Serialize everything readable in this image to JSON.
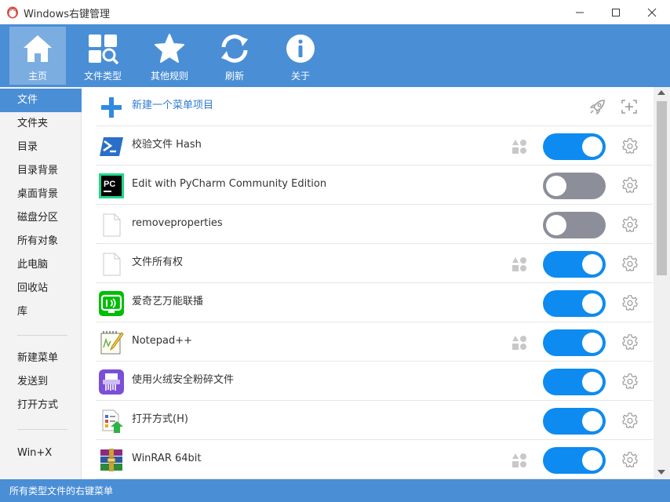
{
  "window": {
    "title": "Windows右键管理"
  },
  "toolbar": {
    "items": [
      {
        "label": "主页",
        "icon": "home-icon",
        "active": true
      },
      {
        "label": "文件类型",
        "icon": "file-type-search-icon",
        "active": false
      },
      {
        "label": "其他规则",
        "icon": "star-icon",
        "active": false
      },
      {
        "label": "刷新",
        "icon": "refresh-icon",
        "active": false
      },
      {
        "label": "关于",
        "icon": "info-icon",
        "active": false
      }
    ]
  },
  "sidebar": {
    "items": [
      {
        "label": "文件",
        "active": true
      },
      {
        "label": "文件夹"
      },
      {
        "label": "目录"
      },
      {
        "label": "目录背景"
      },
      {
        "label": "桌面背景"
      },
      {
        "label": "磁盘分区"
      },
      {
        "label": "所有对象"
      },
      {
        "label": "此电脑"
      },
      {
        "label": "回收站"
      },
      {
        "label": "库"
      },
      {
        "label": "新建菜单"
      },
      {
        "label": "发送到"
      },
      {
        "label": "打开方式"
      },
      {
        "label": "Win+X"
      }
    ]
  },
  "main": {
    "new_item_label": "新建一个菜单项目",
    "rows": [
      {
        "label": "校验文件 Hash",
        "icon": "powershell-icon",
        "enabled": true,
        "perm": true
      },
      {
        "label": "Edit with PyCharm Community Edition",
        "icon": "pycharm-icon",
        "enabled": false,
        "perm": false
      },
      {
        "label": "removeproperties",
        "icon": "blank-file-icon",
        "enabled": false,
        "perm": false
      },
      {
        "label": "文件所有权",
        "icon": "blank-file-icon",
        "enabled": true,
        "perm": true
      },
      {
        "label": "爱奇艺万能联播",
        "icon": "iqiyi-icon",
        "enabled": true,
        "perm": false
      },
      {
        "label": "Notepad++",
        "icon": "notepadpp-icon",
        "enabled": true,
        "perm": true
      },
      {
        "label": "使用火绒安全粉碎文件",
        "icon": "shredder-icon",
        "enabled": true,
        "perm": false
      },
      {
        "label": "打开方式(H)",
        "icon": "open-with-icon",
        "enabled": true,
        "perm": false
      },
      {
        "label": "WinRAR 64bit",
        "icon": "winrar-icon",
        "enabled": true,
        "perm": true
      }
    ]
  },
  "status": {
    "text": "所有类型文件的右键菜单"
  },
  "colors": {
    "accent": "#4a8ed6",
    "toggle_on": "#0d8bf0",
    "toggle_off": "#8c8f99"
  }
}
